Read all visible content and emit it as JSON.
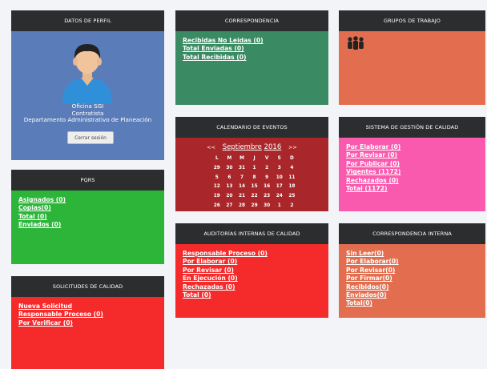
{
  "colors": {
    "header": "#2c2d2f",
    "profile": "#5a7db9",
    "correspondencia": "#3a8a63",
    "grupos": "#e26e4f",
    "pqrs": "#2db53a",
    "calendario": "#a9272a",
    "calidad": "#fa5aae",
    "solicitudes": "#f52a2a",
    "auditorias": "#f52a2a",
    "interna": "#e26e4f"
  },
  "profile": {
    "title": "DATOS DE PERFIL",
    "name": "Oficina SGI",
    "role": "Contratista",
    "department": "Departamento Administrativo de Planeación",
    "logout_label": "Cerrar sesión",
    "avatar_icon": "user-avatar-icon"
  },
  "correspondencia": {
    "title": "CORRESPONDENCIA",
    "links": [
      "Recibidas No Leidas (0)",
      "Total Enviadas (0)",
      "Total Recibidas (0)"
    ]
  },
  "grupos": {
    "title": "GRUPOS DE TRABAJO",
    "icon": "group-people-icon"
  },
  "pqrs": {
    "title": "PQRs",
    "links": [
      "Asignados (0)",
      "Copias(0)",
      "Total (0)",
      "Enviados (0)"
    ]
  },
  "calendario": {
    "title": "CALENDARIO DE EVENTOS",
    "prev": "<<",
    "next": ">>",
    "month": "Septiembre",
    "year": "2016",
    "weekdays": [
      "L",
      "M",
      "M",
      "J",
      "V",
      "S",
      "D"
    ],
    "days": [
      "29",
      "30",
      "31",
      "1",
      "2",
      "3",
      "4",
      "5",
      "6",
      "7",
      "8",
      "9",
      "10",
      "11",
      "12",
      "13",
      "14",
      "15",
      "16",
      "17",
      "18",
      "19",
      "20",
      "21",
      "22",
      "23",
      "24",
      "25",
      "26",
      "27",
      "28",
      "29",
      "30",
      "1",
      "2"
    ]
  },
  "calidad": {
    "title": "SISTEMA DE GESTIÓN DE CALIDAD",
    "links": [
      "Por Elaborar (0)",
      "Por Revisar (0)",
      "Por Publicar (0)",
      "Vigentes (1172)",
      "Rechazados (0)",
      "Total (1172)"
    ]
  },
  "solicitudes": {
    "title": "SOLICITUDES DE CALIDAD",
    "links": [
      "Nueva Solicitud",
      "Responsable Proceso (0)",
      "Por Verificar (0)"
    ]
  },
  "auditorias": {
    "title": "AUDITORÍAS INTERNAS DE CALIDAD",
    "links": [
      "Responsable Proceso (0)",
      "Por Elaborar (0)",
      "Por Revisar (0)",
      "En Ejecución (0)",
      "Rechazadas (0)",
      "Total (0)"
    ]
  },
  "interna": {
    "title": "CORRESPONDENCIA INTERNA",
    "links": [
      "Sin Leer(0)",
      "Por Elaborar(0)",
      "Por Revisar(0)",
      "Por Firmar(0)",
      "Recibidos(0)",
      "Enviados(0)",
      "Total(0)"
    ]
  }
}
